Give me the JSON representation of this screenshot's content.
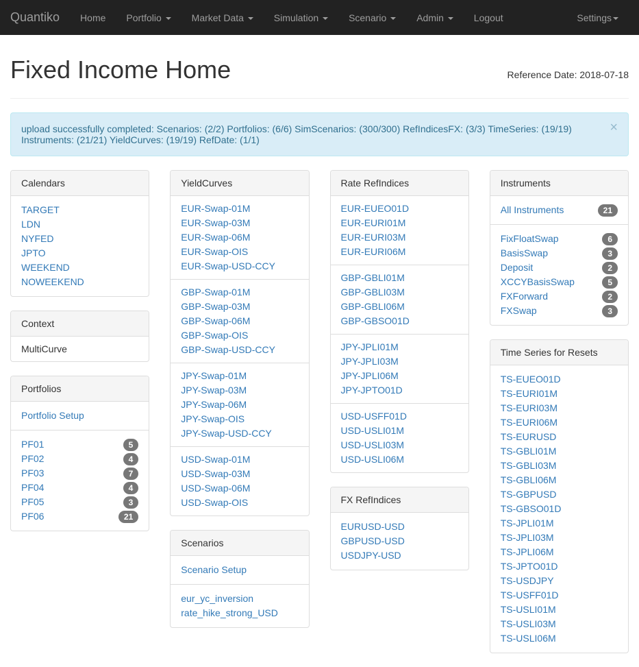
{
  "navbar": {
    "brand": "Quantiko",
    "items": [
      {
        "label": "Home",
        "dropdown": false
      },
      {
        "label": "Portfolio",
        "dropdown": true
      },
      {
        "label": "Market Data",
        "dropdown": true
      },
      {
        "label": "Simulation",
        "dropdown": true
      },
      {
        "label": "Scenario",
        "dropdown": true
      },
      {
        "label": "Admin",
        "dropdown": true
      },
      {
        "label": "Logout",
        "dropdown": false
      }
    ],
    "right": {
      "label": "Settings",
      "dropdown": true
    }
  },
  "header": {
    "title": "Fixed Income Home",
    "refDateLabel": "Reference Date: 2018-07-18"
  },
  "alert": {
    "text": "upload successfully completed: Scenarios: (2/2) Portfolios: (6/6) SimScenarios: (300/300) RefIndicesFX: (3/3) TimeSeries: (19/19) Instruments: (21/21) YieldCurves: (19/19) RefDate: (1/1)"
  },
  "calendars": {
    "title": "Calendars",
    "items": [
      "TARGET",
      "LDN",
      "NYFED",
      "JPTO",
      "WEEKEND",
      "NOWEEKEND"
    ]
  },
  "context": {
    "title": "Context",
    "value": "MultiCurve"
  },
  "portfolios": {
    "title": "Portfolios",
    "setup": "Portfolio Setup",
    "items": [
      {
        "label": "PF01",
        "count": 5
      },
      {
        "label": "PF02",
        "count": 4
      },
      {
        "label": "PF03",
        "count": 7
      },
      {
        "label": "PF04",
        "count": 4
      },
      {
        "label": "PF05",
        "count": 3
      },
      {
        "label": "PF06",
        "count": 21
      }
    ]
  },
  "yieldCurves": {
    "title": "YieldCurves",
    "groups": [
      [
        "EUR-Swap-01M",
        "EUR-Swap-03M",
        "EUR-Swap-06M",
        "EUR-Swap-OIS",
        "EUR-Swap-USD-CCY"
      ],
      [
        "GBP-Swap-01M",
        "GBP-Swap-03M",
        "GBP-Swap-06M",
        "GBP-Swap-OIS",
        "GBP-Swap-USD-CCY"
      ],
      [
        "JPY-Swap-01M",
        "JPY-Swap-03M",
        "JPY-Swap-06M",
        "JPY-Swap-OIS",
        "JPY-Swap-USD-CCY"
      ],
      [
        "USD-Swap-01M",
        "USD-Swap-03M",
        "USD-Swap-06M",
        "USD-Swap-OIS"
      ]
    ]
  },
  "scenarios": {
    "title": "Scenarios",
    "setup": "Scenario Setup",
    "items": [
      "eur_yc_inversion",
      "rate_hike_strong_USD"
    ]
  },
  "rateRefIndices": {
    "title": "Rate RefIndices",
    "groups": [
      [
        "EUR-EUEO01D",
        "EUR-EURI01M",
        "EUR-EURI03M",
        "EUR-EURI06M"
      ],
      [
        "GBP-GBLI01M",
        "GBP-GBLI03M",
        "GBP-GBLI06M",
        "GBP-GBSO01D"
      ],
      [
        "JPY-JPLI01M",
        "JPY-JPLI03M",
        "JPY-JPLI06M",
        "JPY-JPTO01D"
      ],
      [
        "USD-USFF01D",
        "USD-USLI01M",
        "USD-USLI03M",
        "USD-USLI06M"
      ]
    ]
  },
  "fxRefIndices": {
    "title": "FX RefIndices",
    "items": [
      "EURUSD-USD",
      "GBPUSD-USD",
      "USDJPY-USD"
    ]
  },
  "instruments": {
    "title": "Instruments",
    "all": {
      "label": "All Instruments",
      "count": 21
    },
    "items": [
      {
        "label": "FixFloatSwap",
        "count": 6
      },
      {
        "label": "BasisSwap",
        "count": 3
      },
      {
        "label": "Deposit",
        "count": 2
      },
      {
        "label": "XCCYBasisSwap",
        "count": 5
      },
      {
        "label": "FXForward",
        "count": 2
      },
      {
        "label": "FXSwap",
        "count": 3
      }
    ]
  },
  "timeSeries": {
    "title": "Time Series for Resets",
    "items": [
      "TS-EUEO01D",
      "TS-EURI01M",
      "TS-EURI03M",
      "TS-EURI06M",
      "TS-EURUSD",
      "TS-GBLI01M",
      "TS-GBLI03M",
      "TS-GBLI06M",
      "TS-GBPUSD",
      "TS-GBSO01D",
      "TS-JPLI01M",
      "TS-JPLI03M",
      "TS-JPLI06M",
      "TS-JPTO01D",
      "TS-USDJPY",
      "TS-USFF01D",
      "TS-USLI01M",
      "TS-USLI03M",
      "TS-USLI06M"
    ]
  }
}
